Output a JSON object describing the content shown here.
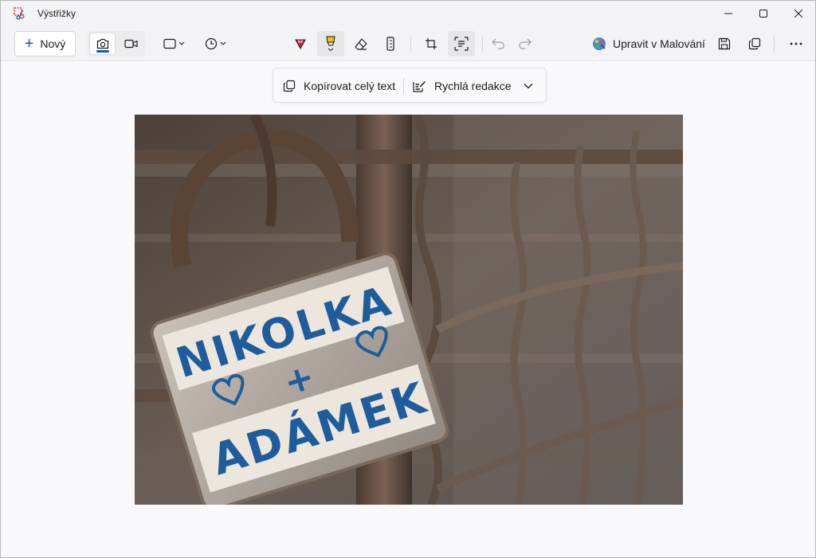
{
  "window": {
    "title": "Výstřižky"
  },
  "toolbar": {
    "new_label": "Nový",
    "edit_in_paint_label": "Upravit v Malování"
  },
  "text_actions": {
    "copy_all_text_label": "Kopírovat celý text",
    "quick_redact_label": "Rychlá redakce"
  },
  "image": {
    "line1": "NIKOLKA",
    "line2": "+",
    "line3": "ADÁMEK"
  },
  "colors": {
    "accent": "#005fb8",
    "pen_red": "#d0222a",
    "highlighter_yellow": "#f5c400"
  }
}
